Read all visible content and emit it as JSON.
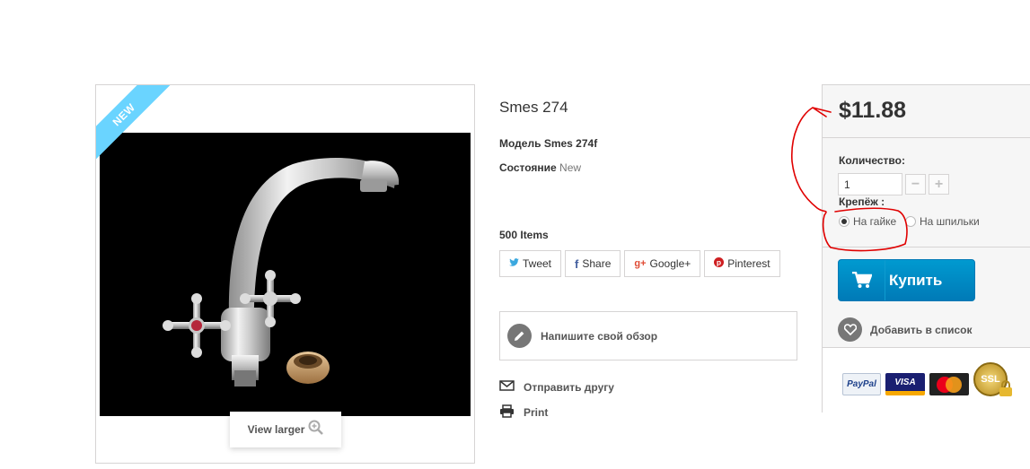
{
  "image": {
    "badge": "NEW",
    "view_larger": "View larger"
  },
  "product": {
    "title": "Smes 274",
    "model_label": "Модель",
    "model_value": "Smes 274f",
    "condition_label": "Состояние",
    "condition_value": "New",
    "items": "500 Items"
  },
  "share": [
    {
      "label": "Tweet",
      "icon": "twitter-icon",
      "color": "#3aa8df"
    },
    {
      "label": "Share",
      "icon": "facebook-icon",
      "color": "#435f9f"
    },
    {
      "label": "Google+",
      "icon": "google-plus-icon",
      "color": "#e04b34"
    },
    {
      "label": "Pinterest",
      "icon": "pinterest-icon",
      "color": "#ce1f21"
    }
  ],
  "review": {
    "label": "Напишите свой обзор",
    "icon": "pencil-icon"
  },
  "links": {
    "send_friend": "Отправить другу",
    "print": "Print"
  },
  "buy_box": {
    "price": "$11.88",
    "quantity_label": "Количество:",
    "quantity_value": "1",
    "minus": "−",
    "plus": "+",
    "mount_label": "Крепёж :",
    "options": [
      {
        "label": "На гайке",
        "selected": true
      },
      {
        "label": "На шпильки",
        "selected": false
      }
    ],
    "buy_label": "Купить",
    "wishlist_label": "Добавить в список",
    "payments": [
      "PayPal",
      "VISA",
      "MasterCard",
      "SSL"
    ]
  },
  "colors": {
    "accent": "#009ad0",
    "ribbon": "#6ad4ff",
    "annotation": "#e00000"
  }
}
